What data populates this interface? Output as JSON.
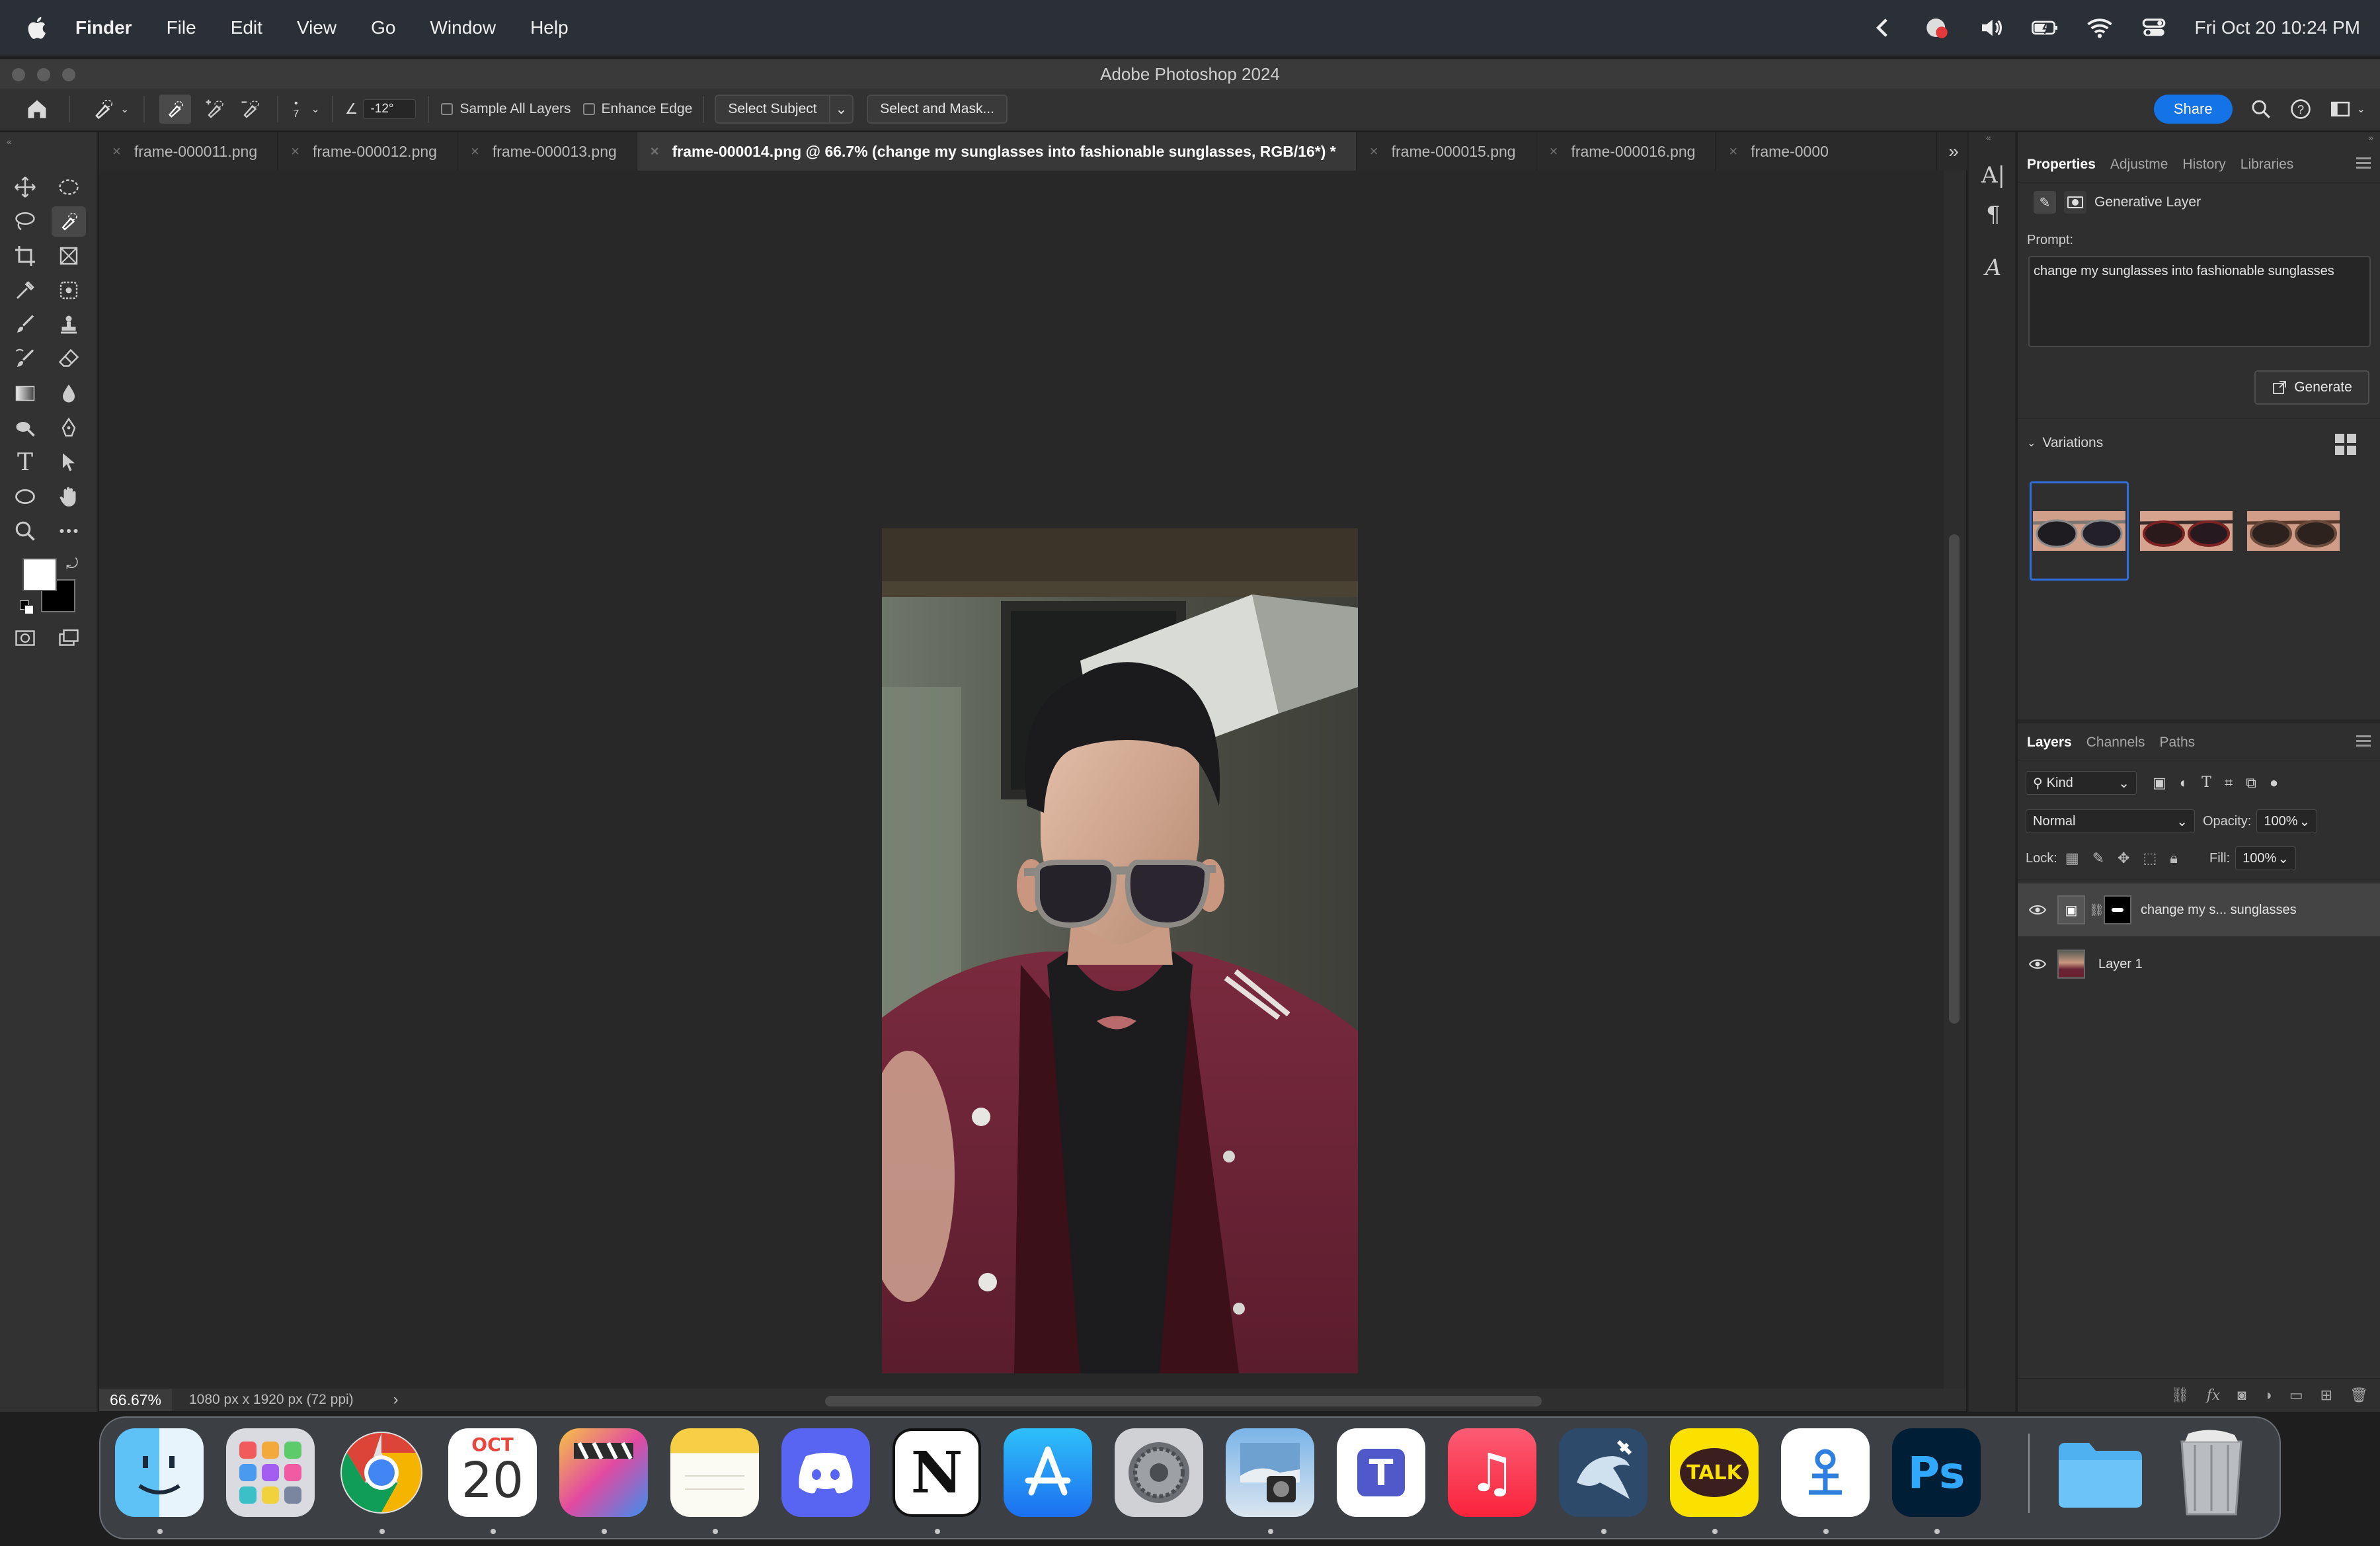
{
  "menubar": {
    "app_name": "Finder",
    "items": [
      "File",
      "Edit",
      "View",
      "Go",
      "Window",
      "Help"
    ],
    "clock": "Fri Oct 20  10:24 PM",
    "status_icons": [
      "chevron-left-icon",
      "screen-record-icon",
      "volume-icon",
      "battery-icon",
      "wifi-icon",
      "control-center-icon"
    ]
  },
  "window": {
    "title": "Adobe Photoshop 2024"
  },
  "options": {
    "brush_size": "7",
    "angle": "-12°",
    "sample_all_layers": "Sample All Layers",
    "enhance_edge": "Enhance Edge",
    "select_subject": "Select Subject",
    "select_and_mask": "Select and Mask...",
    "share": "Share"
  },
  "tabs": [
    {
      "label": "frame-000011.png",
      "active": false
    },
    {
      "label": "frame-000012.png",
      "active": false
    },
    {
      "label": "frame-000013.png",
      "active": false
    },
    {
      "label": "frame-000014.png @ 66.7% (change my sunglasses into fashionable sunglasses, RGB/16*) *",
      "active": true
    },
    {
      "label": "frame-000015.png",
      "active": false
    },
    {
      "label": "frame-000016.png",
      "active": false
    },
    {
      "label": "frame-0000",
      "active": false
    }
  ],
  "status": {
    "zoom": "66.67%",
    "doc_info": "1080 px x 1920 px (72 ppi)",
    "more": "›"
  },
  "properties": {
    "tabs": [
      "Properties",
      "Adjustme",
      "History",
      "Libraries"
    ],
    "layer_type": "Generative Layer",
    "prompt_label": "Prompt:",
    "prompt_text": "change my sunglasses into fashionable sunglasses",
    "generate": "Generate",
    "variations": "Variations",
    "selected_variation": 1
  },
  "layers": {
    "tabs": [
      "Layers",
      "Channels",
      "Paths"
    ],
    "filter": "Kind",
    "blend_mode": "Normal",
    "opacity_label": "Opacity:",
    "opacity": "100%",
    "lock_label": "Lock:",
    "fill_label": "Fill:",
    "fill": "100%",
    "items": [
      {
        "name": "change my s... sunglasses",
        "selected": true
      },
      {
        "name": "Layer 1",
        "selected": false
      }
    ]
  },
  "tools": [
    "move-tool-icon",
    "marquee-tool-icon",
    "lasso-tool-icon",
    "quick-selection-tool-icon",
    "crop-tool-icon",
    "frame-tool-icon",
    "eyedropper-tool-icon",
    "spot-healing-tool-icon",
    "brush-tool-icon",
    "stamp-tool-icon",
    "history-brush-icon",
    "eraser-tool-icon",
    "gradient-tool-icon",
    "blur-tool-icon",
    "dodge-tool-icon",
    "pen-tool-icon",
    "type-tool-icon",
    "path-select-tool-icon",
    "ellipse-tool-icon",
    "hand-tool-icon",
    "zoom-tool-icon",
    "more-tools-icon"
  ],
  "dock": {
    "apps": [
      {
        "name": "finder",
        "label": ""
      },
      {
        "name": "launchpad",
        "label": ""
      },
      {
        "name": "chrome",
        "label": ""
      },
      {
        "name": "calendar",
        "label": "20",
        "month": "OCT"
      },
      {
        "name": "final-cut",
        "label": ""
      },
      {
        "name": "notes",
        "label": ""
      },
      {
        "name": "discord",
        "label": ""
      },
      {
        "name": "notion",
        "label": "N"
      },
      {
        "name": "app-store",
        "label": ""
      },
      {
        "name": "system-settings",
        "label": ""
      },
      {
        "name": "preview",
        "label": ""
      },
      {
        "name": "teams",
        "label": "T"
      },
      {
        "name": "music",
        "label": "♫"
      },
      {
        "name": "mysql-workbench",
        "label": ""
      },
      {
        "name": "kakaotalk",
        "label": "TALK"
      },
      {
        "name": "tool-app",
        "label": ""
      },
      {
        "name": "photoshop",
        "label": "Ps"
      },
      {
        "name": "folder",
        "label": ""
      },
      {
        "name": "trash",
        "label": ""
      }
    ]
  }
}
